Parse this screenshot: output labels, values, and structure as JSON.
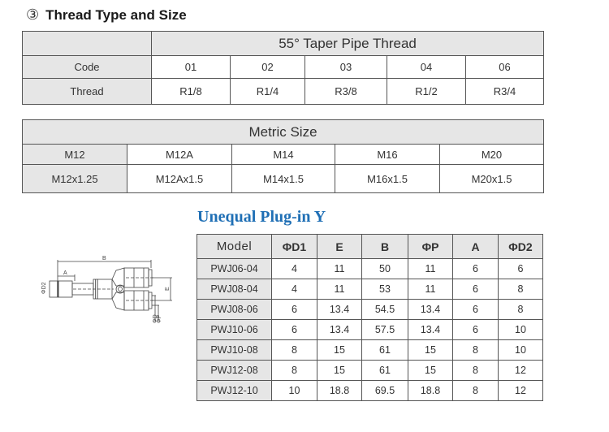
{
  "section": {
    "number": "③",
    "title": "Thread Type and Size"
  },
  "taper_table": {
    "header": "55°  Taper Pipe Thread",
    "row_labels": [
      "Code",
      "Thread"
    ],
    "codes": [
      "01",
      "02",
      "03",
      "04",
      "06"
    ],
    "threads": [
      "R1/8",
      "R1/4",
      "R3/8",
      "R1/2",
      "R3/4"
    ]
  },
  "metric_table": {
    "header": "Metric Size",
    "codes": [
      "M12",
      "M12A",
      "M14",
      "M16",
      "M20"
    ],
    "sizes": [
      "M12x1.25",
      "M12Ax1.5",
      "M14x1.5",
      "M16x1.5",
      "M20x1.5"
    ]
  },
  "product": {
    "title": "Unequal  Plug-in Y",
    "diagram_labels": {
      "b": "B",
      "a": "A",
      "d2": "ΦD2",
      "e": "E",
      "d": "ΦD",
      "p": "ΦP"
    },
    "columns": [
      "Model",
      "ΦD1",
      "E",
      "B",
      "ΦP",
      "A",
      "ΦD2"
    ],
    "rows": [
      [
        "PWJ06-04",
        "4",
        "11",
        "50",
        "11",
        "6",
        "6"
      ],
      [
        "PWJ08-04",
        "4",
        "11",
        "53",
        "11",
        "6",
        "8"
      ],
      [
        "PWJ08-06",
        "6",
        "13.4",
        "54.5",
        "13.4",
        "6",
        "8"
      ],
      [
        "PWJ10-06",
        "6",
        "13.4",
        "57.5",
        "13.4",
        "6",
        "10"
      ],
      [
        "PWJ10-08",
        "8",
        "15",
        "61",
        "15",
        "8",
        "10"
      ],
      [
        "PWJ12-08",
        "8",
        "15",
        "61",
        "15",
        "8",
        "12"
      ],
      [
        "PWJ12-10",
        "10",
        "18.8",
        "69.5",
        "18.8",
        "8",
        "12"
      ]
    ]
  },
  "colors": {
    "title_blue": "#1f6fb5",
    "header_gray": "#e6e6e6",
    "border": "#555555"
  }
}
